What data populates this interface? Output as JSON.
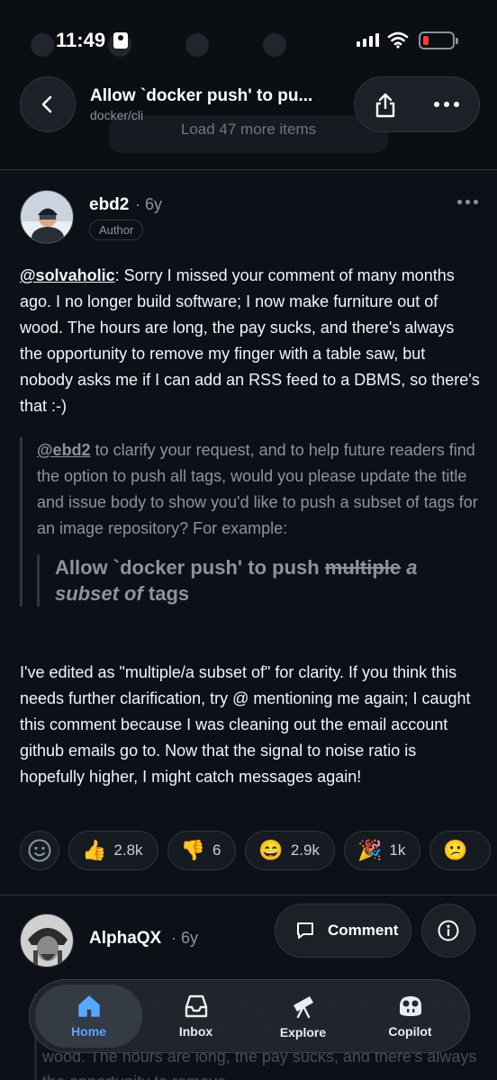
{
  "status_bar": {
    "time": "11:49"
  },
  "header": {
    "title": "Allow `docker push' to pu...",
    "subtitle": "docker/cli",
    "load_more": "Load 47 more items"
  },
  "comment": {
    "author": "ebd2",
    "time": "· 6y",
    "badge": "Author",
    "mention": "@solvaholic",
    "body_rest": ": Sorry I missed your comment of many months ago. I no longer build software; I now make furniture out of wood. The hours are long, the pay sucks, and there's always the opportunity to remove my finger with a table saw, but nobody asks me if I can add an RSS feed to a DBMS, so there's that :-)",
    "quote": {
      "mention": "@ebd2",
      "text": " to clarify your request, and to help future readers find the option to push all tags, would you please update the title and issue body to show you'd like to push a subset of tags for an image repository? For example:",
      "inner_prefix": "Allow `docker push' to push ",
      "inner_struck": "multiple",
      "inner_italic": " a subset of",
      "inner_suffix": " tags"
    },
    "body_after": "I've edited as \"multiple/a subset of\" for clarity. If you think this needs further clarification, try @ mentioning me again; I caught this comment because I was cleaning out the email account github emails go to. Now that the signal to noise ratio is hopefully higher, I might catch messages again!",
    "reactions": [
      {
        "emoji": "👍",
        "icon": "thumbs-up-icon",
        "count": "2.8k"
      },
      {
        "emoji": "👎",
        "icon": "thumbs-down-icon",
        "count": "6"
      },
      {
        "emoji": "😄",
        "icon": "laugh-icon",
        "count": "2.9k"
      },
      {
        "emoji": "🎉",
        "icon": "hooray-icon",
        "count": "1k"
      },
      {
        "emoji": "😕",
        "icon": "confused-icon",
        "count": ""
      }
    ]
  },
  "comment2": {
    "author": "AlphaQX",
    "time": "· 6y",
    "faded_text": "@solvaholic: Sorry I missed your comment of many months ago. I no longer build software; I now make furniture out of wood. The hours are long, the pay sucks, and there's always the opportunity to remove"
  },
  "actions": {
    "comment_label": "Comment"
  },
  "tabs": [
    {
      "label": "Home",
      "icon": "home-icon",
      "active": true
    },
    {
      "label": "Inbox",
      "icon": "inbox-icon",
      "active": false
    },
    {
      "label": "Explore",
      "icon": "telescope-icon",
      "active": false
    },
    {
      "label": "Copilot",
      "icon": "copilot-icon",
      "active": false
    }
  ],
  "colors": {
    "accent": "#58a6ff",
    "background": "#0d1117",
    "battery_low": "#ff3b30"
  }
}
